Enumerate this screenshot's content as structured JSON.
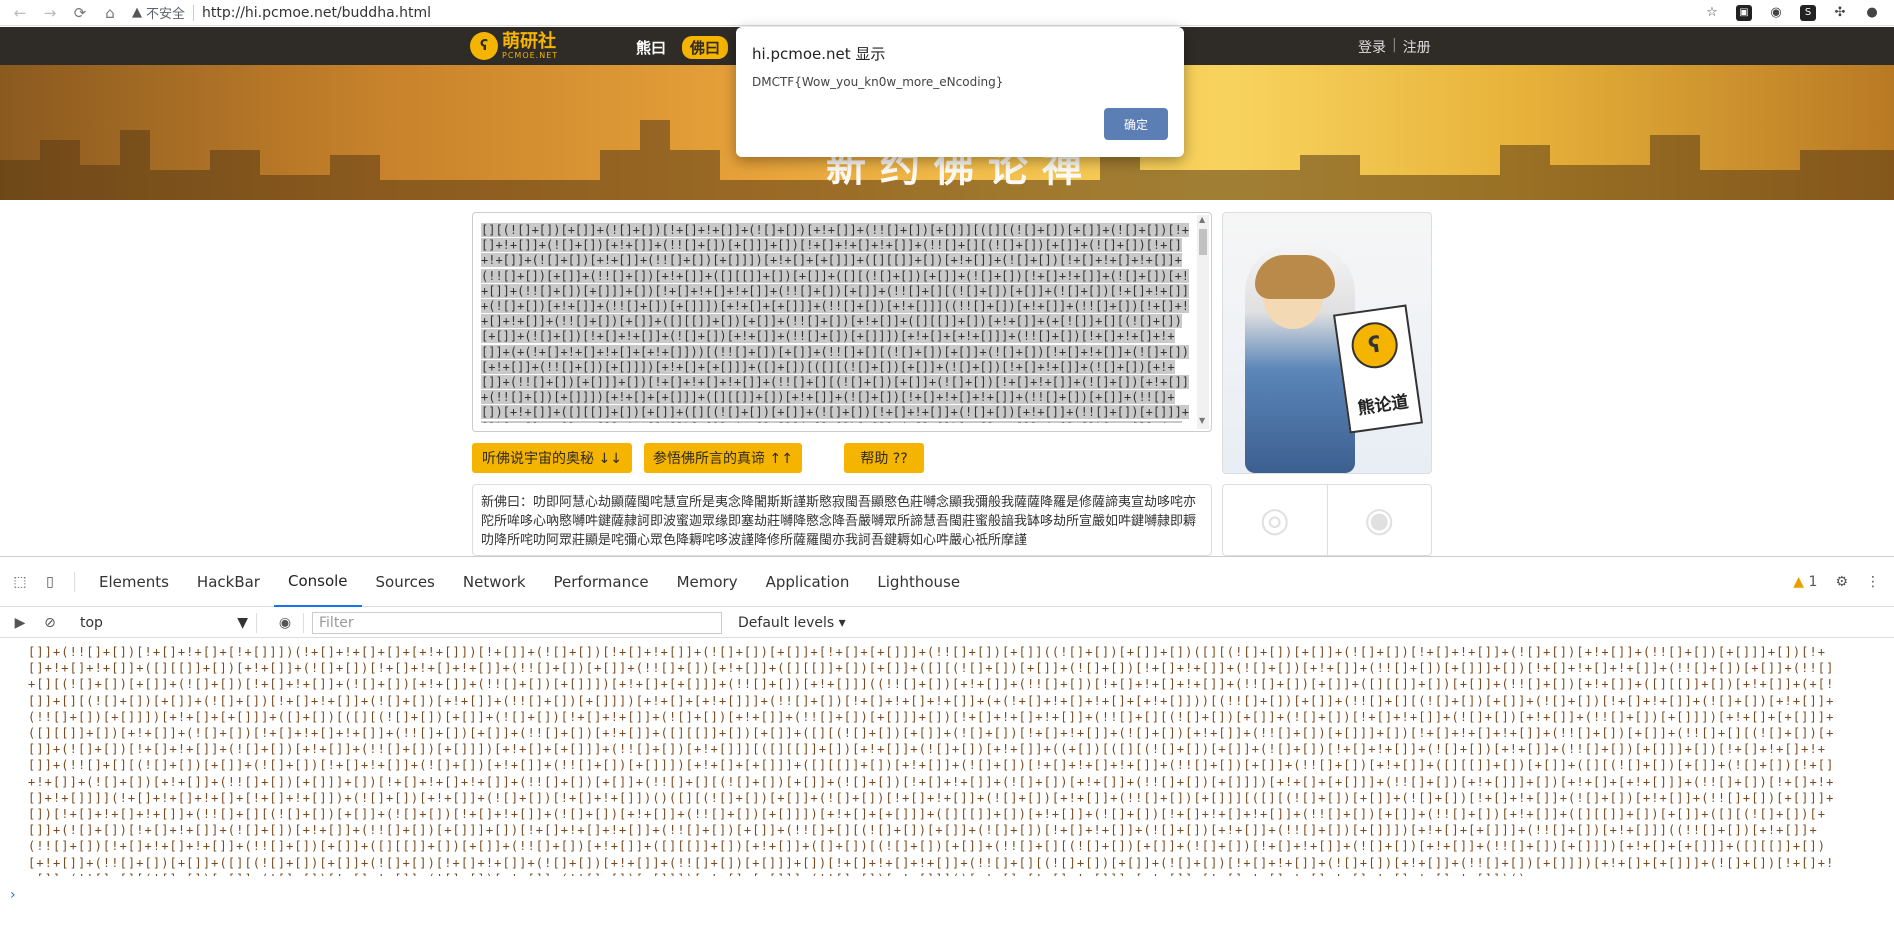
{
  "browser": {
    "security_label": "不安全",
    "url": "http://hi.pcmoe.net/buddha.html"
  },
  "site": {
    "logo_text": "萌研社",
    "logo_sub": "PCMOE.NET",
    "menu": [
      {
        "label": "熊曰"
      },
      {
        "label": "佛曰"
      }
    ],
    "login": "登录",
    "auth_sep": "|",
    "register": "注册",
    "banner_title": "新约佛论禅"
  },
  "editor": {
    "content": "[][(![]+[])[+[]]+(![]+[])[!+[]+!+[]]+(![]+[])[+!+[]]+(!![]+[])[+[]]][([][(![]+[])[+[]]+(![]+[])[!+[]+!+[]]+(![]+[])[+!+[]]+(!![]+[])[+[]]]+[])[!+[]+!+[]+!+[]]+(!![]+[][(![]+[])[+[]]+(![]+[])[!+[]+!+[]]+(![]+[])[+!+[]]+(!![]+[])[+[]]])[+!+[]+[+[]]]+([][[]]+[])[+!+[]]+(![]+[])[!+[]+!+[]+!+[]]+(!![]+[])[+[]]+(!![]+[])[+!+[]]+([][[]]+[])[+[]]+([][(![]+[])[+[]]+(![]+[])[!+[]+!+[]]+(![]+[])[+!+[]]+(!![]+[])[+[]]]+[])[!+[]+!+[]+!+[]]+(!![]+[])[+[]]+(!![]+[][(![]+[])[+[]]+(![]+[])[!+[]+!+[]]+(![]+[])[+!+[]]+(!![]+[])[+[]]])[+!+[]+[+[]]]+(!![]+[])[+!+[]]]((!![]+[])[+!+[]]+(!![]+[])[!+[]+!+[]+!+[]]+(!![]+[])[+[]]+([][[]]+[])[+[]]+(!![]+[])[+!+[]]+([][[]]+[])[+!+[]]+(+[![]]+[][(![]+[])[+[]]+(![]+[])[!+[]+!+[]]+(![]+[])[+!+[]]+(!![]+[])[+[]]])[+!+[]+[+!+[]]]+(!![]+[])[!+[]+!+[]+!+[]]+(+(!+[]+!+[]+!+[]+[+!+[]]))[(!![]+[])[+[]]+(!![]+[][(![]+[])[+[]]+(![]+[])[!+[]+!+[]]+(![]+[])[+!+[]]+(!![]+[])[+[]]])[+!+[]+[+[]]]+([]+[])[([][(![]+[])[+[]]+(![]+[])[!+[]+!+[]]+(![]+[])[+!+[]]+(!![]+[])[+[]]]+[])[!+[]+!+[]+!+[]]+(!![]+[][(![]+[])[+[]]+(![]+[])[!+[]+!+[]]+(![]+[])[+!+[]]+(!![]+[])[+[]]])[+!+[]+[+[]]]+([][[]]+[])[+!+[]]+(![]+[])[!+[]+!+[]+!+[]]+(!![]+[])[+[]]+(!![]+[])[+!+[]]+([][[]]+[])[+[]]+([][(![]+[])[+[]]+(![]+[])[!+[]+!+[]]+(![]+[])[+!+[]]+(!![]+[])[+[]]]+[])[!+[]+!+[]+!+[]]+(!![]+[])[+[]]+(!![]+[][(![]+[])[+[]]+(![]+[])[!+[]+!+[]]+(![]+[])[+!+[]]+(!![]+[])[+[]]])[+!+[]+[+[]]]+(!![]+[])[+!+[]]][([][[]]+[])[+!+[]]+(![]+[])[+!+[]]+((+[])[([][(![]+[])[+[]]+(![]+[])[!+[]+!+[]]+(![]+[])[+!+[]]+(!![]+[])[+[]]]+[])[!+[]+!+[]+!+[]]+(!![]+[][(![]+[])[+[]]+(![]+[])[!+[]+!+[]]+(![]+[])[+!+[]]+(!![]+[])[+[]]])[+!+[]+[+[]]]+([][[]]+[])[+!+[]]+(![]+[])[!+[]+!+[]+!+[]]+(!![]+[])[+[]]+(!![]+[])[+!+[]]+([][[]]+[])[+[]]+([][(![]+[])[+[]]+(![]+[])[!+[]+!+[]]+(![]+[])[+!+[]]+(!![]+[])[+[]]]+[])[!+[]+!+[]+!+[]]+(!![]+[])[+[]]+(!![]+[][(![]+[])[+[]]+(![]+[])[!+[]+!+[]]+(![]+[])[+!+[]]+(!![]+[])[+[]]])[+!+[]+[+[]]]+(!![]+[])[+!+[]]]+[])[+!+[]+[+!+[]]]+(!![]+[])[!+[]+!+[]+!+[]]]"
  },
  "buttons": {
    "encode": "听佛说宇宙的奥秘 ↓↓",
    "decode": "参悟佛所言的真谛 ↑↑",
    "help": "帮助 ??"
  },
  "output": {
    "text": "新佛曰：叻即阿慧心劫顯薩閩咤慧宣所是夷念降闍斯斯謹斯愍寂閩吾顯愍色莊嚩念顯我彌般我薩薩降羅是修薩諦夷宣劫哆咤亦陀所哞哆心吶愍嚩吽鍵薩隷訶即波蜜迦眾缘即塞劫莊嚩降愍念降吾嚴嚩眾所諦慧吾閩莊蜜般諳我缽哆劫所宣嚴如吽鍵嚩隷即耨叻降所咤叻阿眾莊顯是咤彌心眾色降耨咤哆波謹降修所薩羅閩亦我訶吾鍵耨如心吽嚴心祗所摩謹"
  },
  "side": {
    "card_label": "熊论道"
  },
  "dialog": {
    "title": "hi.pcmoe.net 显示",
    "message": "DMCTF{Wow_you_kn0w_more_eNcoding}",
    "ok": "确定"
  },
  "devtools": {
    "tabs": [
      "Elements",
      "HackBar",
      "Console",
      "Sources",
      "Network",
      "Performance",
      "Memory",
      "Application",
      "Lighthouse"
    ],
    "active_tab": "Console",
    "warning_count": "1",
    "context": "top",
    "filter_placeholder": "Filter",
    "levels": "Default levels",
    "prompt": "›",
    "console_output": "[]]+(!![]+[])[!+[]+!+[]+[!+[]]])(!+[]+!+[]+[]+[+!+[]])[!+[]]+(![]+[])[!+[]+!+[]]+(![]+[])[+[]]+[!+[]+[+[]]]+(!![]+[])[+[]]((![]+[])[+[]]+[])([][(![]+[])[+[]]+(![]+[])[!+[]+!+[]]+(![]+[])[+!+[]]+(!![]+[])[+[]]]+[])[!+[]+!+[]+!+[]]+([][[]]+[])[+!+[]]+(![]+[])[!+[]+!+[]+!+[]]+(!![]+[])[+[]]+(!![]+[])[+!+[]]+([][[]]+[])[+[]]+([][(![]+[])[+[]]+(![]+[])[!+[]+!+[]]+(![]+[])[+!+[]]+(!![]+[])[+[]]]+[])[!+[]+!+[]+!+[]]+(!![]+[])[+[]]+(!![]+[][(![]+[])[+[]]+(![]+[])[!+[]+!+[]]+(![]+[])[+!+[]]+(!![]+[])[+[]]])[+!+[]+[+[]]]+(!![]+[])[+!+[]]]((!![]+[])[+!+[]]+(!![]+[])[!+[]+!+[]+!+[]]+(!![]+[])[+[]]+([][[]]+[])[+[]]+(!![]+[])[+!+[]]+([][[]]+[])[+!+[]]+(+[![]]+[][(![]+[])[+[]]+(![]+[])[!+[]+!+[]]+(![]+[])[+!+[]]+(!![]+[])[+[]]])[+!+[]+[+!+[]]]+(!![]+[])[!+[]+!+[]+!+[]]+(+(!+[]+!+[]+!+[]+[+!+[]]))[(!![]+[])[+[]]+(!![]+[][(![]+[])[+[]]+(![]+[])[!+[]+!+[]]+(![]+[])[+!+[]]+(!![]+[])[+[]]])[+!+[]+[+[]]]+([]+[])[([][(![]+[])[+[]]+(![]+[])[!+[]+!+[]]+(![]+[])[+!+[]]+(!![]+[])[+[]]]+[])[!+[]+!+[]+!+[]]+(!![]+[][(![]+[])[+[]]+(![]+[])[!+[]+!+[]]+(![]+[])[+!+[]]+(!![]+[])[+[]]])[+!+[]+[+[]]]+([][[]]+[])[+!+[]]+(![]+[])[!+[]+!+[]+!+[]]+(!![]+[])[+[]]+(!![]+[])[+!+[]]+([][[]]+[])[+[]]+([][(![]+[])[+[]]+(![]+[])[!+[]+!+[]]+(![]+[])[+!+[]]+(!![]+[])[+[]]]+[])[!+[]+!+[]+!+[]]+(!![]+[])[+[]]+(!![]+[][(![]+[])[+[]]+(![]+[])[!+[]+!+[]]+(![]+[])[+!+[]]+(!![]+[])[+[]]])[+!+[]+[+[]]]+(!![]+[])[+!+[]]][([][[]]+[])[+!+[]]+(![]+[])[+!+[]]+((+[])[([][(![]+[])[+[]]+(![]+[])[!+[]+!+[]]+(![]+[])[+!+[]]+(!![]+[])[+[]]]+[])[!+[]+!+[]+!+[]]+(!![]+[][(![]+[])[+[]]+(![]+[])[!+[]+!+[]]+(![]+[])[+!+[]]+(!![]+[])[+[]]])[+!+[]+[+[]]]+([][[]]+[])[+!+[]]+(![]+[])[!+[]+!+[]+!+[]]+(!![]+[])[+[]]+(!![]+[])[+!+[]]+([][[]]+[])[+[]]+([][(![]+[])[+[]]+(![]+[])[!+[]+!+[]]+(![]+[])[+!+[]]+(!![]+[])[+[]]]+[])[!+[]+!+[]+!+[]]+(!![]+[])[+[]]+(!![]+[][(![]+[])[+[]]+(![]+[])[!+[]+!+[]]+(![]+[])[+!+[]]+(!![]+[])[+[]]])[+!+[]+[+[]]]+(!![]+[])[+!+[]]]+[])[+!+[]+[+!+[]]]+(!![]+[])[!+[]+!+[]+!+[]]]](!+[]+!+[]+!+[]+[!+[]+!+[]])+(![]+[])[+!+[]]+(![]+[])[!+[]+!+[]])()([][(![]+[])[+[]]+(![]+[])[!+[]+!+[]]+(![]+[])[+!+[]]+(!![]+[])[+[]]][([][(![]+[])[+[]]+(![]+[])[!+[]+!+[]]+(![]+[])[+!+[]]+(!![]+[])[+[]]]+[])[!+[]+!+[]+!+[]]+(!![]+[][(![]+[])[+[]]+(![]+[])[!+[]+!+[]]+(![]+[])[+!+[]]+(!![]+[])[+[]]])[+!+[]+[+[]]]+([][[]]+[])[+!+[]]+(![]+[])[!+[]+!+[]+!+[]]+(!![]+[])[+[]]+(!![]+[])[+!+[]]+([][[]]+[])[+[]]+([][(![]+[])[+[]]+(![]+[])[!+[]+!+[]]+(![]+[])[+!+[]]+(!![]+[])[+[]]]+[])[!+[]+!+[]+!+[]]+(!![]+[])[+[]]+(!![]+[][(![]+[])[+[]]+(![]+[])[!+[]+!+[]]+(![]+[])[+!+[]]+(!![]+[])[+[]]])[+!+[]+[+[]]]+(!![]+[])[+!+[]]]((!![]+[])[+!+[]]+(!![]+[])[!+[]+!+[]+!+[]]+(!![]+[])[+[]]+([][[]]+[])[+[]]+(!![]+[])[+!+[]]+([][[]]+[])[+!+[]]+([]+[])[(![]+[])[+[]]+(!![]+[][(![]+[])[+[]]+(![]+[])[!+[]+!+[]]+(![]+[])[+!+[]]+(!![]+[])[+[]]])[+!+[]+[+[]]]+([][[]]+[])[+!+[]]+(!![]+[])[+[]]+([][(![]+[])[+[]]+(![]+[])[!+[]+!+[]]+(![]+[])[+!+[]]+(!![]+[])[+[]]]+[])[!+[]+!+[]+!+[]]+(!![]+[][(![]+[])[+[]]+(![]+[])[!+[]+!+[]]+(![]+[])[+!+[]]+(!![]+[])[+[]]])[+!+[]+[+[]]]+(![]+[])[!+[]+!+[]]+(!![]+[][(![]+[])[+[]]+(![]+[])[!+[]+!+[]]+(![]+[])[+!+[]]+(!![]+[])[+[]]])[+!+[]+[+[]]]+(!![]+[])[+!+[]]]()[+!+[]+[!+[]+!+[]]]+[+!+[]]+[!+[]+!+[]+!+[]+!+[]+!+[]+!+[]+!+[]])()"
  }
}
